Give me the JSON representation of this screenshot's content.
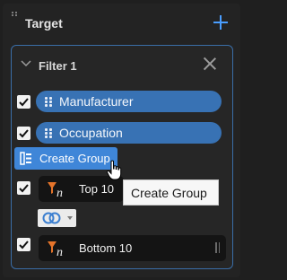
{
  "header": {
    "title": "Target",
    "add_icon": "plus-icon",
    "accent": "#4a9eff"
  },
  "filter": {
    "title": "Filter 1",
    "fields": [
      {
        "label": "Manufacturer",
        "checked": true
      },
      {
        "label": "Occupation",
        "checked": true
      }
    ],
    "create_group_label": "Create Group",
    "conditions": [
      {
        "label": "Top 10",
        "checked": true,
        "icon": "top-n-filter-icon"
      },
      {
        "label": "Bottom 10",
        "checked": true,
        "icon": "bottom-n-filter-icon"
      }
    ],
    "tooltip": "Create Group",
    "logic_icon": "intersect-circles-icon"
  },
  "colors": {
    "pill": "#3872b4",
    "card_border": "#3a6ea8",
    "filter_icon": "#e5742a",
    "button": "#3f86d8"
  }
}
